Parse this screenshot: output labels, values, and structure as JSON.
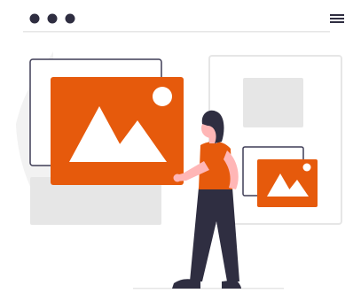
{
  "illustration": {
    "colors": {
      "accent": "#e65a0c",
      "dark": "#2f2e41",
      "light_gray": "#e6e6e6",
      "frame_gray": "#3f3d56",
      "white": "#ffffff",
      "skin": "#ffb6b6"
    },
    "window_controls": [
      "dot-icon",
      "dot-icon",
      "dot-icon"
    ],
    "menu_icon": "hamburger-menu-icon",
    "content": {
      "large_image_icon": "image-placeholder-icon",
      "small_image_icon": "image-placeholder-icon"
    }
  }
}
